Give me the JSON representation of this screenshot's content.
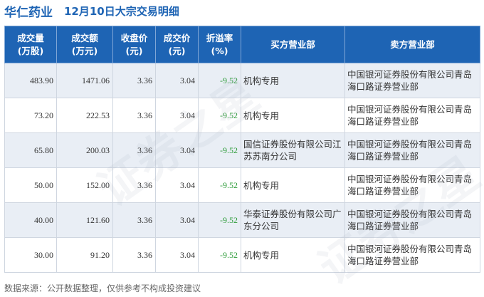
{
  "header": {
    "stock_name": "华仁药业",
    "subtitle": "12月10日大宗交易明细"
  },
  "table": {
    "columns": [
      {
        "line1": "成交量",
        "line2": "(万股)"
      },
      {
        "line1": "成交额",
        "line2": "(万元)"
      },
      {
        "line1": "收盘价",
        "line2": "(元)"
      },
      {
        "line1": "成交价",
        "line2": "(元)"
      },
      {
        "line1": "折溢率",
        "line2": "(%)"
      },
      {
        "line1": "买方营业部",
        "line2": ""
      },
      {
        "line1": "卖方营业部",
        "line2": ""
      }
    ],
    "rows": [
      {
        "volume": "483.90",
        "amount": "1471.06",
        "close": "3.36",
        "price": "3.04",
        "premium": "-9.52",
        "buyer": "机构专用",
        "seller": "中国银河证券股份有限公司青岛海口路证券营业部"
      },
      {
        "volume": "73.20",
        "amount": "222.53",
        "close": "3.36",
        "price": "3.04",
        "premium": "-9.52",
        "buyer": "机构专用",
        "seller": "中国银河证券股份有限公司青岛海口路证券营业部"
      },
      {
        "volume": "65.80",
        "amount": "200.03",
        "close": "3.36",
        "price": "3.04",
        "premium": "-9.52",
        "buyer": "国信证券股份有限公司江苏苏南分公司",
        "seller": "中国银河证券股份有限公司青岛海口路证券营业部"
      },
      {
        "volume": "50.00",
        "amount": "152.00",
        "close": "3.36",
        "price": "3.04",
        "premium": "-9.52",
        "buyer": "机构专用",
        "seller": "中国银河证券股份有限公司青岛海口路证券营业部"
      },
      {
        "volume": "40.00",
        "amount": "121.60",
        "close": "3.36",
        "price": "3.04",
        "premium": "-9.52",
        "buyer": "华泰证券股份有限公司广东分公司",
        "seller": "中国银河证券股份有限公司青岛海口路证券营业部"
      },
      {
        "volume": "30.00",
        "amount": "91.20",
        "close": "3.36",
        "price": "3.04",
        "premium": "-9.52",
        "buyer": "机构专用",
        "seller": "中国银河证券股份有限公司青岛海口路证券营业部"
      }
    ]
  },
  "footer": {
    "source": "数据来源：公开数据整理，仅供参考不构成投资建议"
  },
  "watermark": "证券之星",
  "colors": {
    "header_bg": "#1e64b4",
    "title": "#1e64b4",
    "premium": "#2e9c3a",
    "row_alt": "#e9eef5"
  }
}
